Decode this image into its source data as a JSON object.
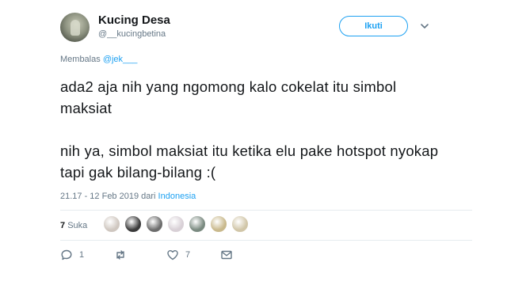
{
  "user": {
    "name": "Kucing Desa",
    "handle": "@__kucingbetina"
  },
  "follow_button": "Ikuti",
  "reply": {
    "prefix": "Membalas",
    "mention": "@jek___"
  },
  "tweet": {
    "text": "ada2 aja nih yang ngomong kalo cokelat itu simbol maksiat\n\nnih ya, simbol maksiat itu ketika elu pake hotspot nyokap tapi gak bilang-bilang :(",
    "time": "21.17 - 12 Feb 2019",
    "from_word": "dari",
    "place": "Indonesia"
  },
  "likes": {
    "count": "7",
    "label": "Suka",
    "avatar_colors": [
      "#cfc7c0",
      "#3a3a3a",
      "#6c6c6c",
      "#d8d0d6",
      "#7a8a80",
      "#c9b98c",
      "#d1c6a8"
    ]
  },
  "actions": {
    "reply_count": "1",
    "retweet_count": "",
    "like_count": "7"
  },
  "colors": {
    "accent": "#1da1f2",
    "muted": "#657786",
    "text": "#14171a",
    "divider": "#e6ecf0"
  }
}
